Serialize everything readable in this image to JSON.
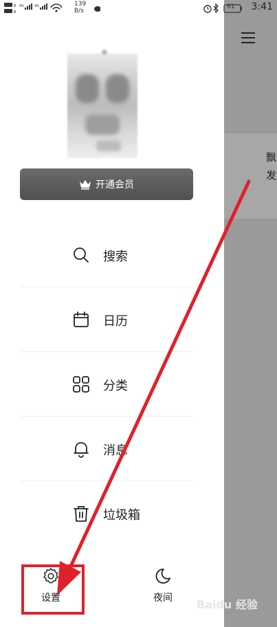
{
  "status_bar": {
    "net_speed_value": "139",
    "net_speed_unit": "B/s",
    "battery": "61",
    "time": "3:41"
  },
  "drawer": {
    "vip_label": "开通会员",
    "menu": [
      {
        "label": "搜索",
        "icon": "search-icon"
      },
      {
        "label": "日历",
        "icon": "calendar-icon"
      },
      {
        "label": "分类",
        "icon": "grid-icon"
      },
      {
        "label": "消息",
        "icon": "bell-icon"
      },
      {
        "label": "垃圾箱",
        "icon": "trash-icon"
      }
    ],
    "settings_label": "设置",
    "night_label": "夜间"
  },
  "background_content": {
    "line1": "飘",
    "line2": "发"
  },
  "watermark": "Baidu 经验",
  "colors": {
    "annotation_red": "#e0212b",
    "vip_bg": "#5a5a5a",
    "overlay_gray": "#9a9a9a"
  }
}
